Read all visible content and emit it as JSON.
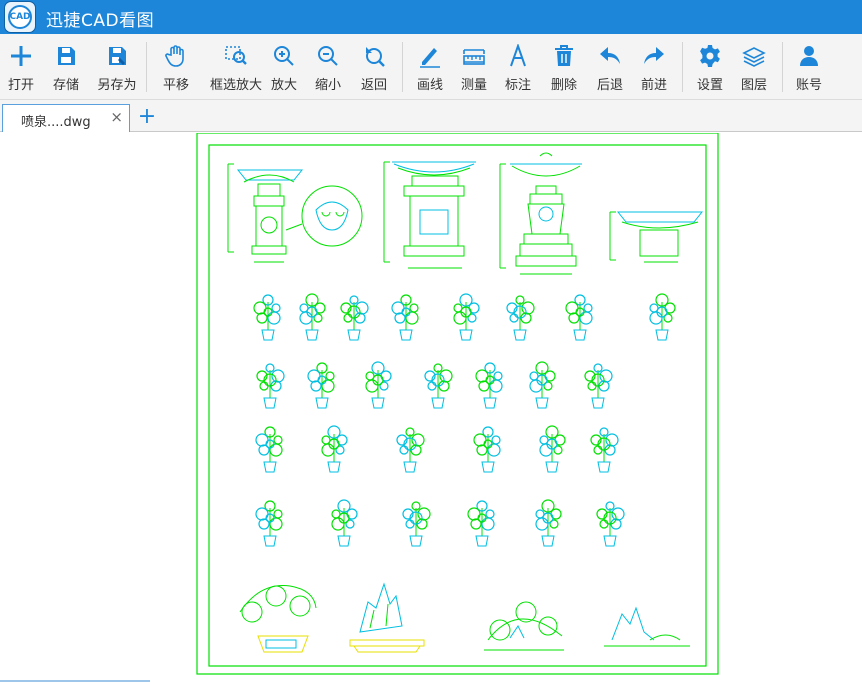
{
  "app": {
    "title": "迅捷CAD看图",
    "logo_text": "CAD"
  },
  "toolbar": {
    "open": "打开",
    "save": "存储",
    "save_as": "另存为",
    "pan": "平移",
    "zoom_box": "框选放大",
    "zoom_in": "放大",
    "zoom_out": "缩小",
    "back": "返回",
    "line": "画线",
    "measure": "测量",
    "annotate": "标注",
    "delete": "删除",
    "undo": "后退",
    "redo": "前进",
    "settings": "设置",
    "layers": "图层",
    "account": "账号"
  },
  "tabs": {
    "file_name": "喷泉....dwg",
    "close": "×",
    "add": "+"
  },
  "colors": {
    "title_bar": "#1d86d9",
    "icon_blue": "#1d86d9",
    "cad_green": "#00e000",
    "cad_cyan": "#00bfe0",
    "cad_yellow": "#e8e000"
  }
}
